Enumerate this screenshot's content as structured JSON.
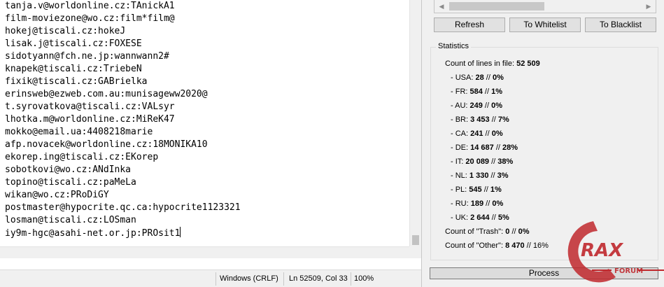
{
  "editor": {
    "lines": [
      "tanja.v@worldonline.cz:TAnickA1",
      "film-moviezone@wo.cz:film*film@",
      "hokej@tiscali.cz:hokeJ",
      "lisak.j@tiscali.cz:FOXESE",
      "sidotyann@fch.ne.jp:wannwann2#",
      "knapek@tiscali.cz:TriebeN",
      "fixik@tiscali.cz:GABrielka",
      "erinsweb@ezweb.com.au:munisageww2020@",
      "t.syrovatkova@tiscali.cz:VALsyr",
      "lhotka.m@worldonline.cz:MiReK47",
      "mokko@email.ua:4408218marie",
      "afp.novacek@worldonline.cz:18MONIKA10",
      "ekorep.ing@tiscali.cz:EKorep",
      "sobotkovi@wo.cz:ANdInka",
      "topino@tiscali.cz:paMeLa",
      "wikan@wo.cz:PRoDiGY",
      "postmaster@hypocrite.qc.ca:hypocrite1123321",
      "losman@tiscali.cz:LOSman",
      "iy9m-hgc@asahi-net.or.jp:PROsit1"
    ]
  },
  "statusbar": {
    "line_endings": "Windows (CRLF)",
    "position": "Ln 52509, Col 33",
    "zoom": "100%"
  },
  "buttons": {
    "refresh": "Refresh",
    "to_whitelist": "To Whitelist",
    "to_blacklist": "To Blacklist",
    "process": "Process"
  },
  "statistics": {
    "title": "Statistics",
    "count_lines_label": "Count of lines in file:",
    "count_lines_value": "52 509",
    "countries": [
      {
        "label": "- USA:",
        "value": "28",
        "sep": " // ",
        "percent": "0%"
      },
      {
        "label": "- FR:",
        "value": "584",
        "sep": " // ",
        "percent": "1%"
      },
      {
        "label": "- AU:",
        "value": "249",
        "sep": " // ",
        "percent": "0%"
      },
      {
        "label": "- BR:",
        "value": "3 453",
        "sep": " // ",
        "percent": "7%"
      },
      {
        "label": "- CA:",
        "value": "241",
        "sep": " // ",
        "percent": "0%"
      },
      {
        "label": "- DE:",
        "value": "14 687",
        "sep": " // ",
        "percent": "28%"
      },
      {
        "label": "- IT:",
        "value": "20 089",
        "sep": " // ",
        "percent": "38%"
      },
      {
        "label": "- NL:",
        "value": "1 330",
        "sep": " // ",
        "percent": "3%"
      },
      {
        "label": "- PL:",
        "value": "545",
        "sep": " // ",
        "percent": "1%"
      },
      {
        "label": "- RU:",
        "value": "189",
        "sep": " // ",
        "percent": "0%"
      },
      {
        "label": "- UK:",
        "value": "2 644",
        "sep": " // ",
        "percent": "5%"
      }
    ],
    "trash_label": "Count of \"Trash\":",
    "trash_value": "0",
    "trash_sep": " // ",
    "trash_percent": "0%",
    "other_label": "Count of \"Other\":",
    "other_value": "8 470",
    "other_sep": " // ",
    "other_percent": "16%"
  },
  "watermark": {
    "text": "RAX",
    "subtext": "FORUM",
    "color": "#c0282d"
  }
}
